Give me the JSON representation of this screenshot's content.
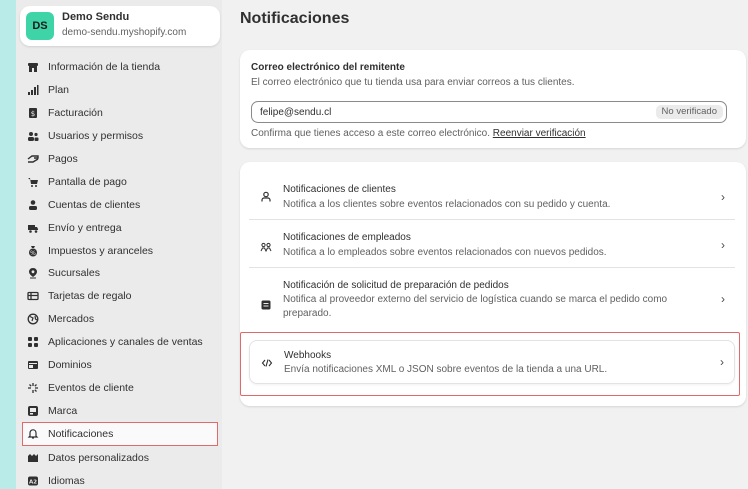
{
  "store": {
    "avatar_initials": "DS",
    "name": "Demo Sendu",
    "domain": "demo-sendu.myshopify.com"
  },
  "sidebar": {
    "items": [
      {
        "label": "Información de la tienda",
        "icon": "store-icon"
      },
      {
        "label": "Plan",
        "icon": "plan-chart-icon"
      },
      {
        "label": "Facturación",
        "icon": "billing-icon"
      },
      {
        "label": "Usuarios y permisos",
        "icon": "users-icon"
      },
      {
        "label": "Pagos",
        "icon": "payments-icon"
      },
      {
        "label": "Pantalla de pago",
        "icon": "cart-icon"
      },
      {
        "label": "Cuentas de clientes",
        "icon": "customer-icon"
      },
      {
        "label": "Envío y entrega",
        "icon": "truck-icon"
      },
      {
        "label": "Impuestos y aranceles",
        "icon": "tax-icon"
      },
      {
        "label": "Sucursales",
        "icon": "location-pin-icon"
      },
      {
        "label": "Tarjetas de regalo",
        "icon": "gift-card-icon"
      },
      {
        "label": "Mercados",
        "icon": "globe-icon"
      },
      {
        "label": "Aplicaciones y canales de ventas",
        "icon": "apps-icon"
      },
      {
        "label": "Dominios",
        "icon": "domains-icon"
      },
      {
        "label": "Eventos de cliente",
        "icon": "sparkle-icon"
      },
      {
        "label": "Marca",
        "icon": "brand-icon"
      },
      {
        "label": "Notificaciones",
        "icon": "bell-icon"
      },
      {
        "label": "Datos personalizados",
        "icon": "data-icon"
      },
      {
        "label": "Idiomas",
        "icon": "languages-icon"
      }
    ]
  },
  "main": {
    "title": "Notificaciones",
    "sender_email": {
      "title": "Correo electrónico del remitente",
      "description": "El correo electrónico que tu tienda usa para enviar correos a tus clientes.",
      "value": "felipe@sendu.cl",
      "badge": "No verificado",
      "help_text": "Confirma que tienes acceso a este correo electrónico.",
      "help_link": "Reenviar verificación"
    },
    "rows": [
      {
        "title": "Notificaciones de clientes",
        "description": "Notifica a los clientes sobre eventos relacionados con su pedido y cuenta.",
        "icon": "person-icon"
      },
      {
        "title": "Notificaciones de empleados",
        "description": "Notifica a lo empleados sobre eventos relacionados con nuevos pedidos.",
        "icon": "staff-icon"
      },
      {
        "title": "Notificación de solicitud de preparación de pedidos",
        "description": "Notifica al proveedor externo del servicio de logística cuando se marca el pedido como preparado.",
        "icon": "fulfillment-icon"
      },
      {
        "title": "Webhooks",
        "description": "Envía notificaciones XML o JSON sobre eventos de la tienda a una URL.",
        "icon": "code-icon"
      }
    ]
  },
  "colors": {
    "accent": "#3ed4a8",
    "highlight_border": "#e06a6a"
  }
}
